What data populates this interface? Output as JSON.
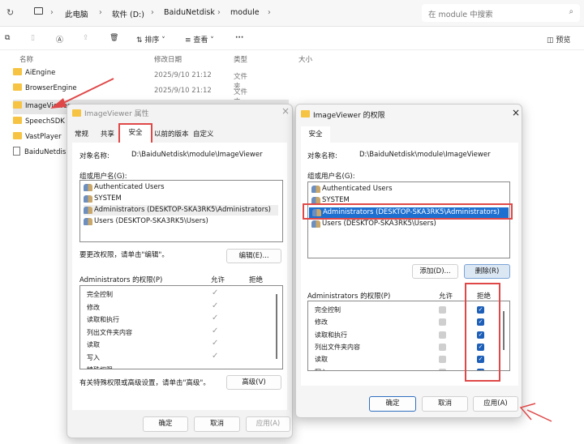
{
  "explorer": {
    "breadcrumb": [
      "此电脑",
      "软件 (D:)",
      "BaiduNetdisk",
      "module"
    ],
    "search_placeholder": "在 module 中搜索",
    "toolbar": {
      "sort": "排序",
      "view": "查看",
      "more": "···",
      "preview": "预览"
    },
    "columns": [
      "名称",
      "修改日期",
      "类型",
      "大小"
    ],
    "files": [
      {
        "name": "AiEngine",
        "date": "2025/9/10 21:12",
        "type": "文件夹"
      },
      {
        "name": "BrowserEngine",
        "date": "2025/9/10 21:12",
        "type": "文件夹"
      },
      {
        "name": "ImageViewer",
        "date": "",
        "type": ""
      },
      {
        "name": "SpeechSDK",
        "date": "",
        "type": ""
      },
      {
        "name": "VastPlayer",
        "date": "",
        "type": ""
      },
      {
        "name": "BaiduNetdisk",
        "date": "",
        "type": ""
      }
    ]
  },
  "properties": {
    "title": "ImageViewer 属性",
    "tabs": [
      "常规",
      "共享",
      "安全",
      "以前的版本",
      "自定义"
    ],
    "object_label": "对象名称:",
    "object_path": "D:\\BaiduNetdisk\\module\\ImageViewer",
    "group_label": "组或用户名(G):",
    "users": [
      "Authenticated Users",
      "SYSTEM",
      "Administrators (DESKTOP-SKA3RK5\\Administrators)",
      "Users (DESKTOP-SKA3RK5\\Users)"
    ],
    "change_hint": "要更改权限，请单击\"编辑\"。",
    "edit_button": "编辑(E)...",
    "perm_label": "Administrators 的权限(P)",
    "allow": "允许",
    "deny": "拒绝",
    "perms": [
      "完全控制",
      "修改",
      "读取和执行",
      "列出文件夹内容",
      "读取",
      "写入",
      "特殊权限"
    ],
    "advanced_hint": "有关特殊权限或高级设置，请单击\"高级\"。",
    "advanced_button": "高级(V)",
    "ok": "确定",
    "cancel": "取消",
    "apply": "应用(A)"
  },
  "permissions": {
    "title": "ImageViewer 的权限",
    "tab": "安全",
    "object_label": "对象名称:",
    "object_path": "D:\\BaiduNetdisk\\module\\ImageViewer",
    "group_label": "组或用户名(G):",
    "users": [
      "Authenticated Users",
      "SYSTEM",
      "Administrators (DESKTOP-SKA3RK5\\Administrators)",
      "Users (DESKTOP-SKA3RK5\\Users)"
    ],
    "add_button": "添加(D)...",
    "remove_button": "删除(R)",
    "perm_label": "Administrators 的权限(P)",
    "allow": "允许",
    "deny": "拒绝",
    "perms": [
      "完全控制",
      "修改",
      "读取和执行",
      "列出文件夹内容",
      "读取",
      "写入"
    ],
    "deny_checked": [
      true,
      true,
      true,
      true,
      true,
      true
    ],
    "ok": "确定",
    "cancel": "取消",
    "apply": "应用(A)",
    "accent": "#1d5fb8"
  }
}
